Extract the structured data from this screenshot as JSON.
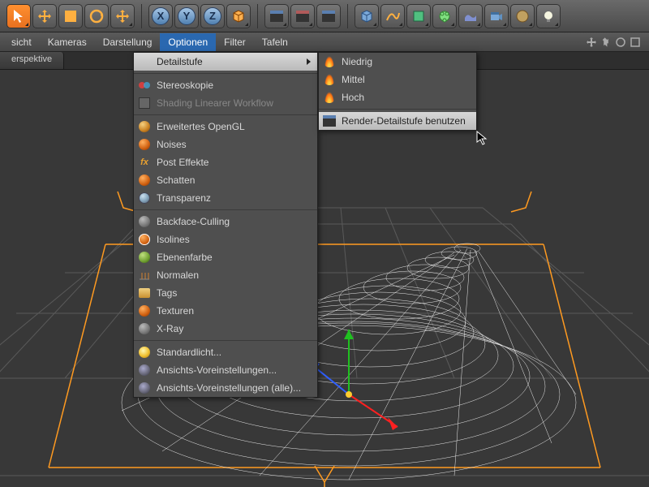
{
  "toolbar": {
    "axis_x": "X",
    "axis_y": "Y",
    "axis_z": "Z"
  },
  "menubar": {
    "items": [
      "sicht",
      "Kameras",
      "Darstellung",
      "Optionen",
      "Filter",
      "Tafeln"
    ]
  },
  "tab": {
    "label": "erspektive"
  },
  "options_menu": {
    "detailstufe": "Detailstufe",
    "stereoskopie": "Stereoskopie",
    "shading_linear": "Shading Linearer Workflow",
    "erweitertes_opengl": "Erweitertes OpenGL",
    "noises": "Noises",
    "post_effekte": "Post Effekte",
    "schatten": "Schatten",
    "transparenz": "Transparenz",
    "backface": "Backface-Culling",
    "isolines": "Isolines",
    "ebenenfarbe": "Ebenenfarbe",
    "normalen": "Normalen",
    "tags": "Tags",
    "texturen": "Texturen",
    "xray": "X-Ray",
    "standardlicht": "Standardlicht...",
    "ansichts_vor": "Ansichts-Voreinstellungen...",
    "ansichts_vor_alle": "Ansichts-Voreinstellungen (alle)..."
  },
  "detail_submenu": {
    "niedrig": "Niedrig",
    "mittel": "Mittel",
    "hoch": "Hoch",
    "render_detail": "Render-Detailstufe benutzen"
  }
}
